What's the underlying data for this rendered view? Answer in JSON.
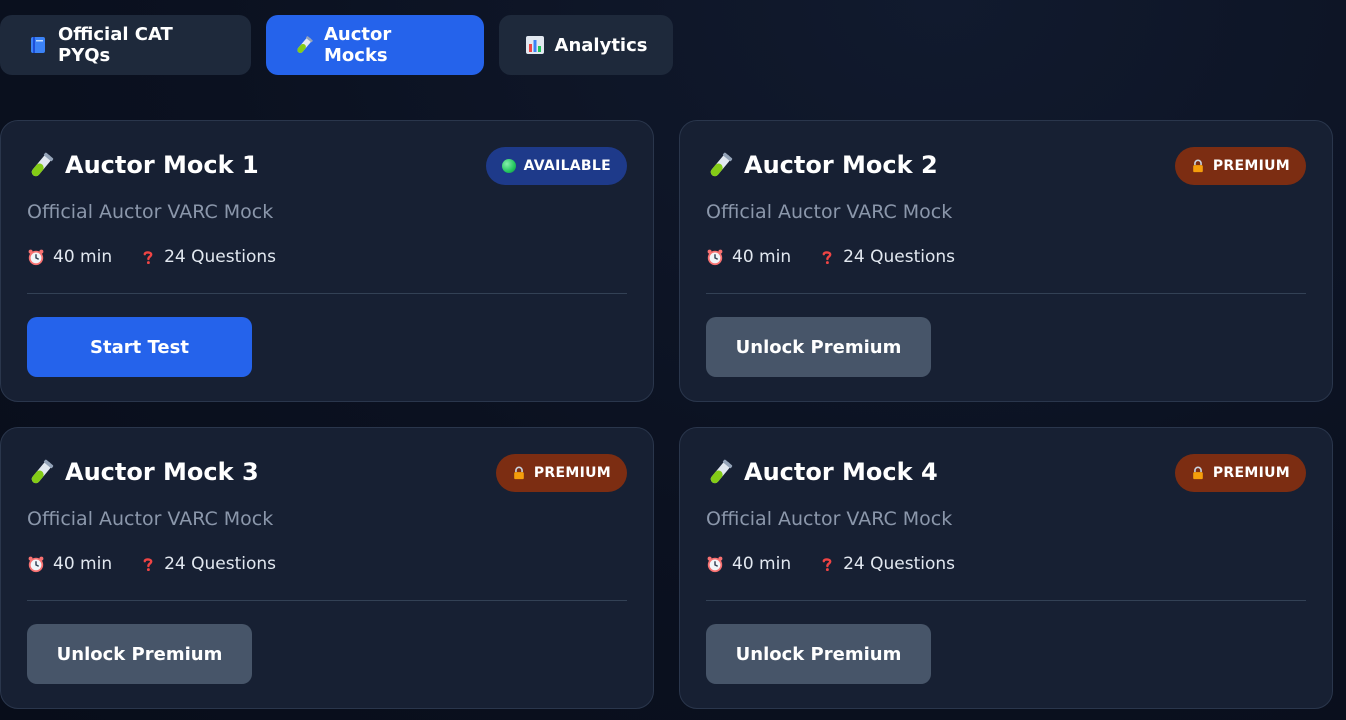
{
  "tabs": [
    {
      "label": "Official CAT PYQs",
      "icon": "book-icon",
      "active": false
    },
    {
      "label": "Auctor Mocks",
      "icon": "test-tube-icon",
      "active": true
    },
    {
      "label": "Analytics",
      "icon": "bar-chart-icon",
      "active": false
    }
  ],
  "cards": [
    {
      "title": "Auctor Mock 1",
      "subtitle": "Official Auctor VARC Mock",
      "duration": "40 min",
      "questions": "24 Questions",
      "badge": "AVAILABLE",
      "button": "Start Test"
    },
    {
      "title": "Auctor Mock 2",
      "subtitle": "Official Auctor VARC Mock",
      "duration": "40 min",
      "questions": "24 Questions",
      "badge": "PREMIUM",
      "button": "Unlock Premium"
    },
    {
      "title": "Auctor Mock 3",
      "subtitle": "Official Auctor VARC Mock",
      "duration": "40 min",
      "questions": "24 Questions",
      "badge": "PREMIUM",
      "button": "Unlock Premium"
    },
    {
      "title": "Auctor Mock 4",
      "subtitle": "Official Auctor VARC Mock",
      "duration": "40 min",
      "questions": "24 Questions",
      "badge": "PREMIUM",
      "button": "Unlock Premium"
    }
  ],
  "colors": {
    "accent": "#2563eb",
    "card_bg": "#172033",
    "available_badge": "#1e3a8a",
    "premium_badge": "#7c2d12",
    "locked_button": "#475569"
  }
}
